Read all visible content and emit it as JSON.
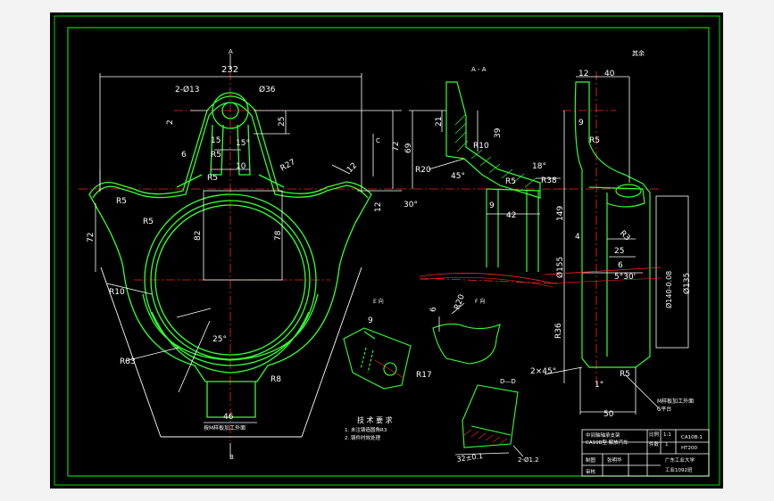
{
  "colors": {
    "background": "#000000",
    "page": "#f3f3f3",
    "frame": "#00d800",
    "outline": "#33ff33",
    "dimension": "#ffffff",
    "centerline": "#ff2222",
    "hatch": "#33ff33"
  },
  "dims": {
    "top_232": "232",
    "holes_2phi13": "2-Ø13",
    "phi36": "Ø36",
    "d25": "25",
    "d2": "2",
    "d15": "15",
    "ang15": "15°",
    "d6": "6",
    "r5_top": "R5",
    "d10": "10",
    "r5_inner": "R5",
    "r27": "R27",
    "r5_left": "R5",
    "r5_left2": "R5",
    "d72_left": "72",
    "d82": "82",
    "d78": "78",
    "r10": "R10",
    "r83": "R83",
    "ang25": "25°",
    "r8": "R8",
    "d46": "46",
    "d72_right": "72",
    "d69": "69",
    "d12_a": "12",
    "d12_b": "12",
    "ang30": "30°",
    "ang45": "45°",
    "d21": "21",
    "d39": "39",
    "r10_mid": "R10",
    "r20": "R20",
    "ang18": "18°",
    "r5_mid": "R5",
    "r38": "R38",
    "d9_mid": "9",
    "d42": "42",
    "d12_right": "12",
    "d40": "40",
    "d9_right": "9",
    "r5_right": "R5",
    "r3": "R3",
    "d149": "149",
    "d4": "4",
    "d25_right": "25",
    "d6_right": "6",
    "ang5_30": "5°30'",
    "phi155": "Ø155",
    "phi140": "Ø140-0.08",
    "phi135": "Ø135",
    "r36": "R36",
    "ch2x45": "2×45°",
    "r5_bottom": "R5",
    "ang1": "1°",
    "d50": "50",
    "d6_e": "6",
    "r20_f": "R20",
    "d9_g": "9",
    "r17": "R17",
    "d2_phi": "2-Ø1.2",
    "d32": "32±0.1"
  },
  "labels": {
    "section_a_top": "A",
    "section_b_bottom": "B",
    "section_c": "C",
    "section_a_mid": "A - A",
    "roughness": "其余",
    "view_e": "E 向",
    "view_f": "F 向",
    "section_dd": "D—D",
    "note_left": "按M样板加工外面",
    "note_right": "M样板加工外面",
    "note_right2": "C平台",
    "tech_title": "技 术 要 求",
    "tech_1": "1. 未注铸造圆角R3",
    "tech_2": "2. 铸件时效处理"
  },
  "title_block": {
    "name1": "中间轴轴承支架",
    "name2": "CA10B型 解放汽车",
    "scale_label": "比例",
    "scale": "1:1",
    "qty_label": "件数",
    "qty": "1",
    "drawing_no": "CA10B-1",
    "material": "HT200",
    "drawn_label": "制图",
    "drawn": "张明华",
    "check_label": "审核",
    "school": "广东工业大学",
    "class": "工业1092班"
  }
}
